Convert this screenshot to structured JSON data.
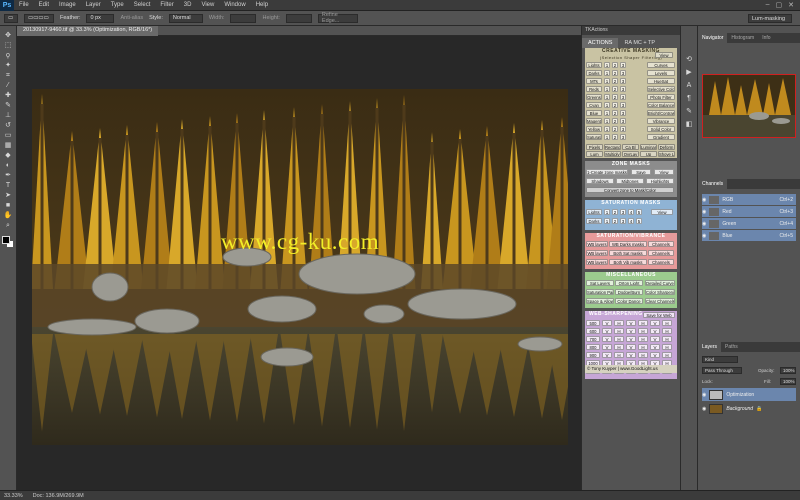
{
  "app": {
    "logo": "Ps"
  },
  "menu": [
    "File",
    "Edit",
    "Image",
    "Layer",
    "Type",
    "Select",
    "Filter",
    "3D",
    "View",
    "Window",
    "Help"
  ],
  "window_controls": [
    "–",
    "▢",
    "✕"
  ],
  "options": {
    "feather_label": "Feather:",
    "feather_value": "0 px",
    "antialias": "Anti-alias",
    "style_label": "Style:",
    "style_value": "Normal",
    "width_label": "Width:",
    "height_label": "Height:",
    "refine": "Refine Edge...",
    "workspace": "Lum-masking"
  },
  "document": {
    "tab": "20130917-9460.tif @ 33.3% (Optimization, RGB/16*)",
    "watermark": "www.cg-ku.com"
  },
  "status": {
    "zoom": "33.33%",
    "doc": "Doc: 136.9M/269.9M"
  },
  "actions_panel": {
    "header": "TKActions",
    "tabs": [
      "ACTIONS",
      "RA MC + TP"
    ],
    "sections": {
      "creative": {
        "title": "CREATIVE MASKING",
        "sub": "(Selection Shaper Filtering)",
        "view": "View"
      },
      "left_btns": [
        "Lights",
        "Darks",
        "MTs",
        "Reds",
        "Greens",
        "Cyan",
        "Blue",
        "Magenta",
        "Yellow",
        "Saturation"
      ],
      "right_btns": [
        "Curves",
        "Levels",
        "HueSat",
        "Selective Color",
        "Photo Filter",
        "Color Balance",
        "Bright/Contrast",
        "Vibrance",
        "Solid Color",
        "Gradient"
      ],
      "bottom_btns": [
        "Pixels",
        "Rectangle",
        "Ca Bl",
        "Luminance",
        "Deform",
        "Lum",
        "Multiply",
        "OvrLay",
        "Up",
        "Shove Layer"
      ],
      "numbers": [
        "1",
        "2",
        "3",
        "4",
        "5",
        "6",
        "7"
      ],
      "zone": {
        "title": "ZONE MASKS",
        "row1": "1-Create zone masks",
        "save": "Save",
        "view": "View",
        "row2a": "Shadows",
        "row2b": "Midtones",
        "row2c": "Highlights",
        "convert": "Convert zone to Mask/Color"
      },
      "sat_mask": {
        "title": "SATURATION MASKS",
        "left": [
          "Lights",
          "Darks"
        ],
        "right_label": "View"
      },
      "sat_vib": {
        "title": "SATURATION/VIBRANCE",
        "rows": [
          [
            "WB layers",
            "WB Darks masks",
            "Channels"
          ],
          [
            "WB layers",
            "Both Sat masks",
            "Channels"
          ],
          [
            "WB layers",
            "Both Vib masks",
            "Channels"
          ]
        ]
      },
      "misc": {
        "title": "MISCELLANEOUS",
        "rows": [
          [
            "Sat Layers",
            "Orton Light",
            "Detailed Curve"
          ],
          [
            "Saturation Painting",
            "Dodge/Burn",
            "Color Sharpening"
          ],
          [
            "Space & Allow",
            "Color Dance",
            "Clear Channels"
          ]
        ]
      },
      "web": {
        "title": "WEB-SHARPENING",
        "save": "Save for Web",
        "sizes": [
          "500",
          "600",
          "700",
          "800",
          "900",
          "1000",
          "1200"
        ],
        "marks": [
          "V",
          "H",
          "V",
          "H",
          "V",
          "H",
          "V"
        ]
      }
    },
    "credit": "© Tony Kuyper | www.GoodLight.us"
  },
  "right_panels": {
    "nav_tabs": [
      "Navigator",
      "Histogram",
      "Info"
    ],
    "ch_tabs": [
      "Channels"
    ],
    "channels": [
      {
        "name": "RGB",
        "shortcut": "Ctrl+2"
      },
      {
        "name": "Red",
        "shortcut": "Ctrl+3"
      },
      {
        "name": "Green",
        "shortcut": "Ctrl+4"
      },
      {
        "name": "Blue",
        "shortcut": "Ctrl+5"
      }
    ],
    "layer_tabs": [
      "Layers",
      "Paths"
    ],
    "kind": "Kind",
    "blend": "Pass Through",
    "opacity_label": "Opacity:",
    "opacity": "100%",
    "lock_label": "Lock:",
    "fill_label": "Fill:",
    "fill": "100%",
    "layers": [
      {
        "name": "Optimization",
        "selected": true
      },
      {
        "name": "Background",
        "selected": false
      }
    ]
  },
  "colors": {
    "accent_select": "#6b86ad",
    "panel_bg": "#535353",
    "watermark": "#f2ee28"
  },
  "icons": [
    "move-icon",
    "marquee-icon",
    "lasso-icon",
    "magic-wand-icon",
    "crop-icon",
    "eyedropper-icon",
    "healing-icon",
    "brush-icon",
    "stamp-icon",
    "history-brush-icon",
    "eraser-icon",
    "gradient-icon",
    "blur-icon",
    "dodge-icon",
    "pen-icon",
    "type-icon",
    "path-select-icon",
    "shape-icon",
    "hand-icon",
    "zoom-icon"
  ]
}
